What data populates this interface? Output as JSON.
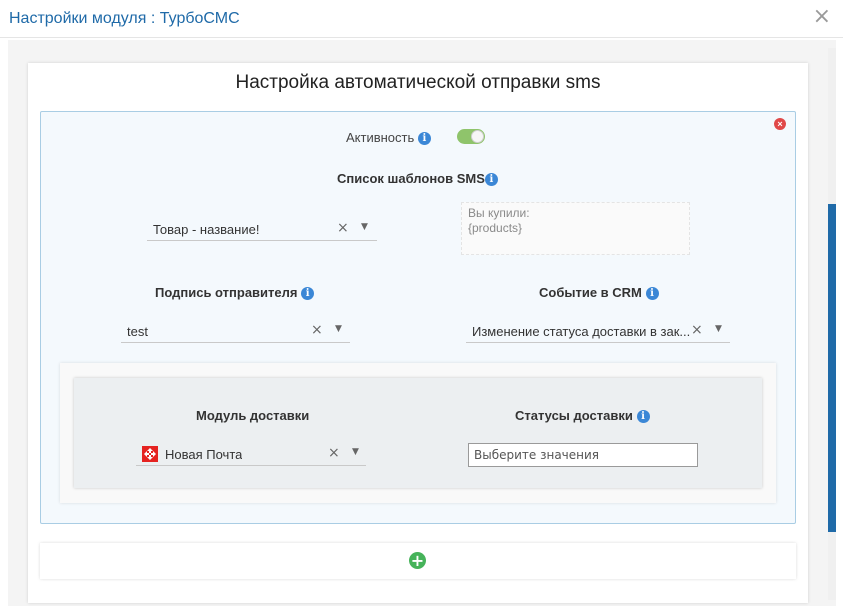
{
  "modal": {
    "title": "Настройки модуля : ТурбоСМС",
    "close_glyph": "×"
  },
  "card": {
    "title": "Настройка автоматической отправки sms"
  },
  "rule": {
    "remove_glyph": "×",
    "active": {
      "label": "Активность",
      "enabled": true
    },
    "templates": {
      "label": "Список шаблонов SMS",
      "selected": "Товар - название!",
      "preview_lines": [
        "Вы купили:",
        "{products}"
      ]
    },
    "sender": {
      "label": "Подпись отправителя",
      "selected": "test"
    },
    "crm_event": {
      "label": "Событие в CRM",
      "selected": "Изменение статуса доставки в зак..."
    },
    "delivery": {
      "module_label": "Модуль доставки",
      "module_selected": "Новая Почта",
      "statuses_label": "Статусы доставки",
      "statuses_placeholder": "Выберите значения"
    }
  },
  "add_rule_glyph": "+",
  "icons": {
    "info": "i",
    "clear": "×",
    "dropdown": "▼"
  },
  "colors": {
    "accent": "#1f6aa8",
    "toggle_on": "#8fc46b",
    "remove": "#e04848",
    "add": "#46b35a",
    "nova_poshta": "#e52321"
  }
}
